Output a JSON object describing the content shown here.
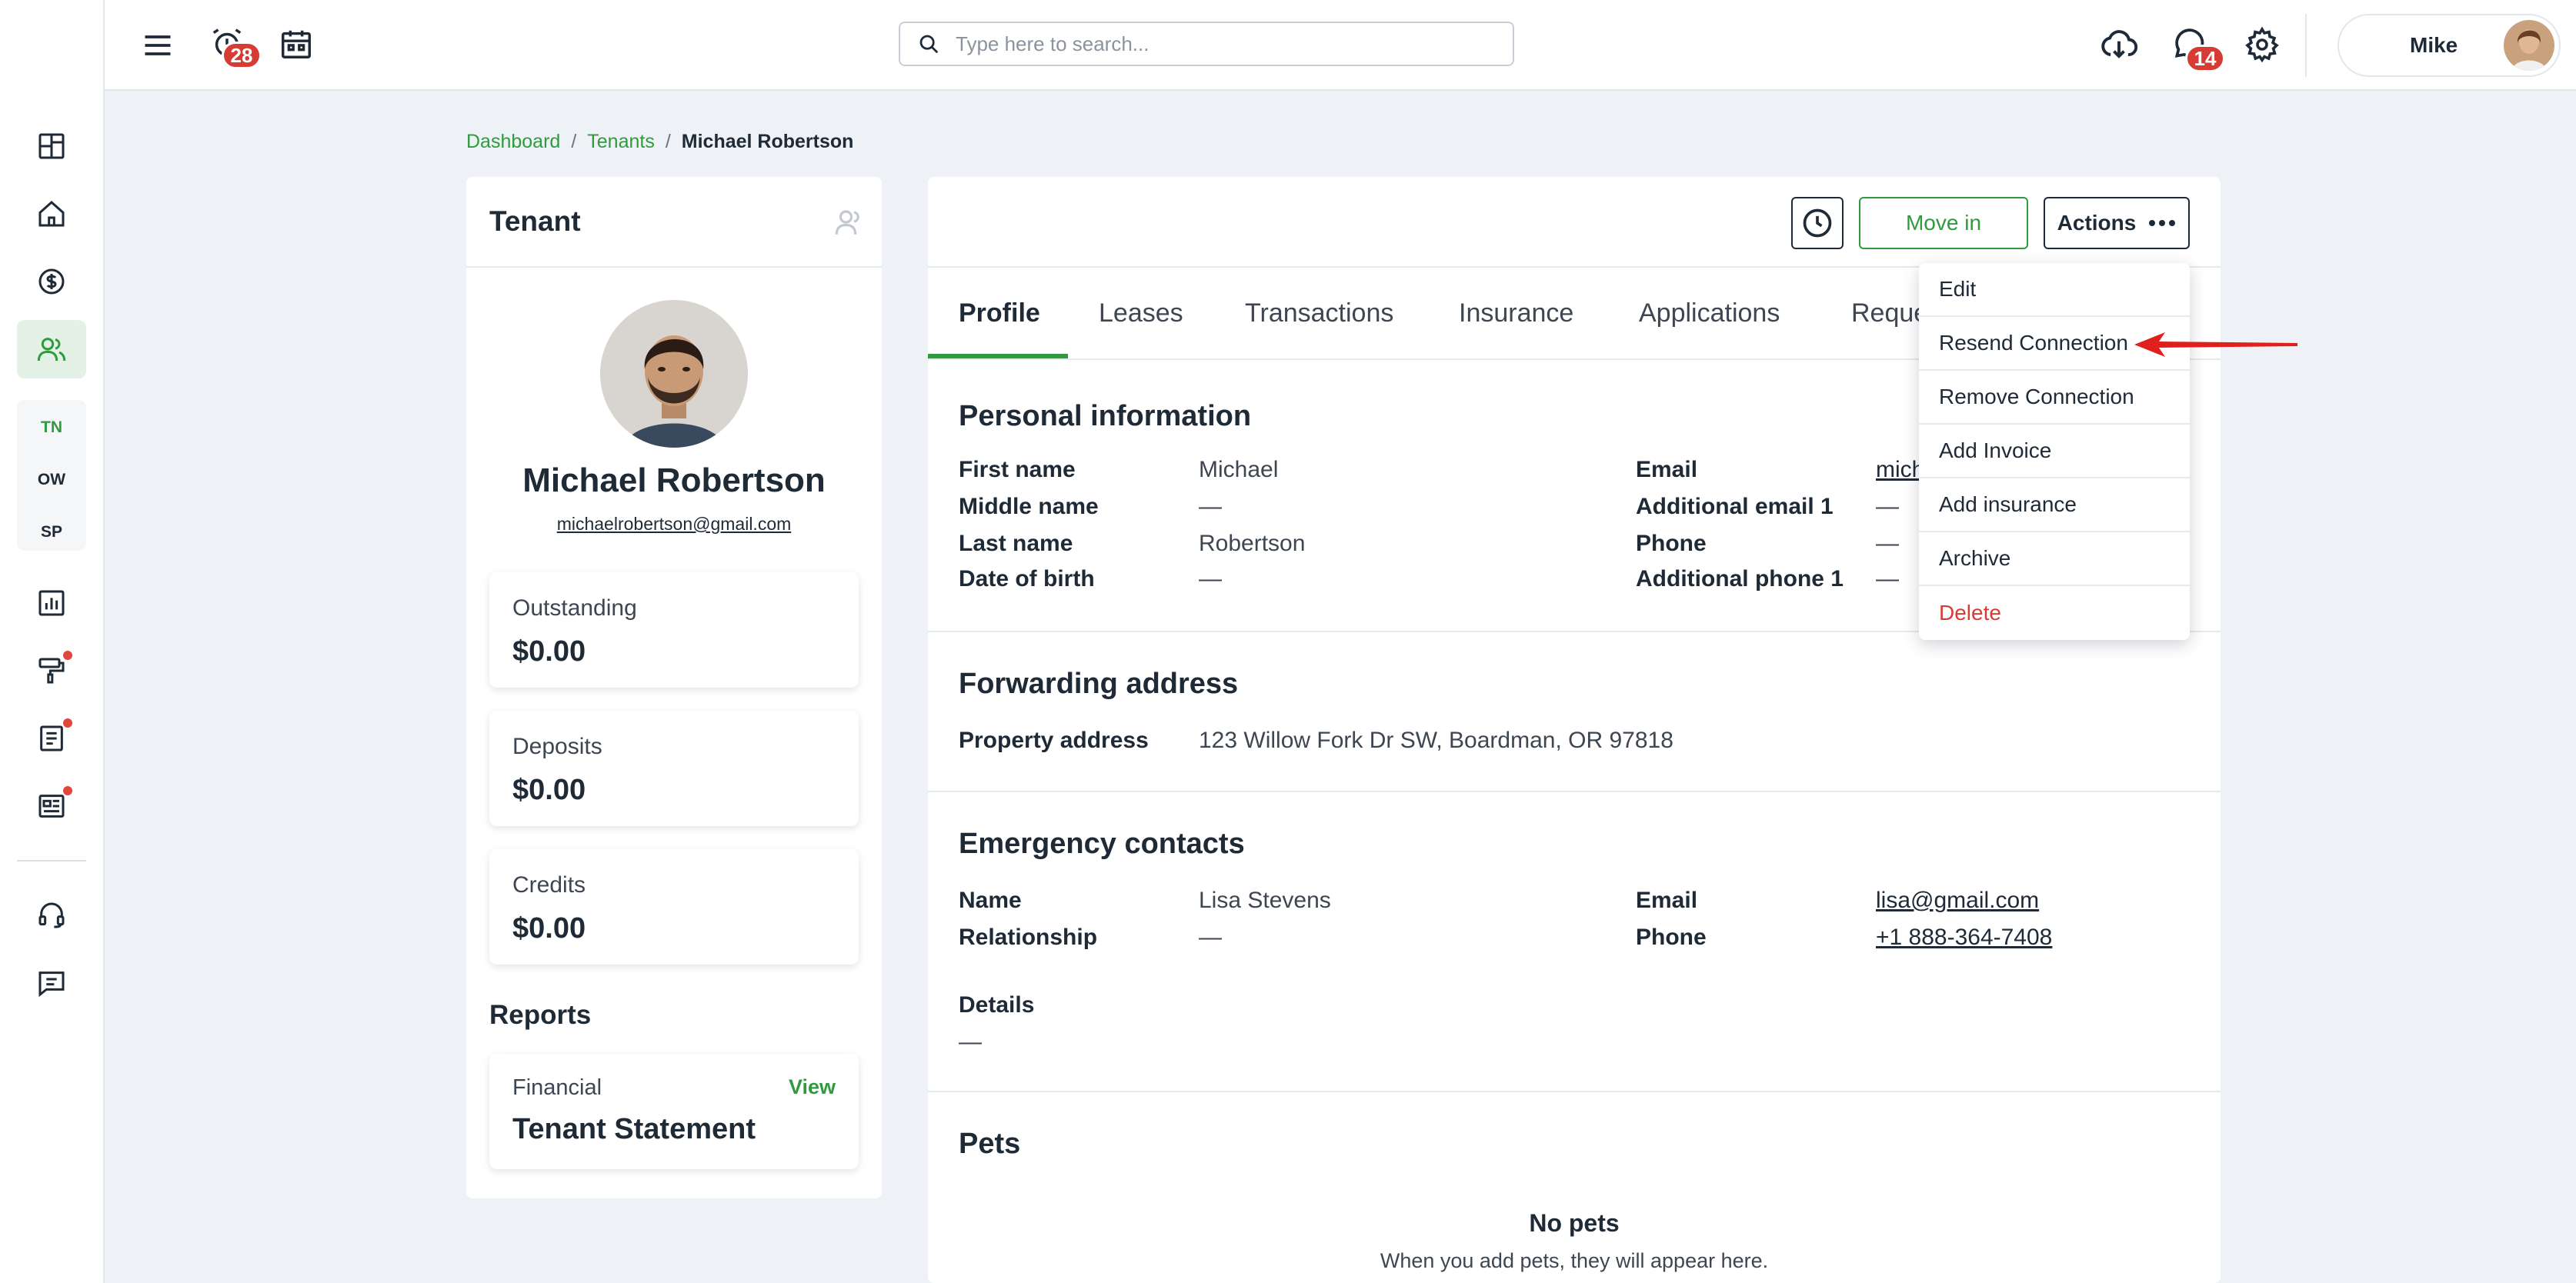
{
  "topbar": {
    "alerts_badge": "28",
    "messages_badge": "14",
    "search_placeholder": "Type here to search...",
    "user_name": "Mike"
  },
  "sidebar": {
    "items": [
      {
        "icon": "dashboard-grid-icon"
      },
      {
        "icon": "home-icon"
      },
      {
        "icon": "dollar-circle-icon"
      },
      {
        "icon": "people-icon",
        "active": true
      }
    ],
    "sub_items": [
      "TN",
      "OW",
      "SP"
    ],
    "bottom_items": [
      {
        "icon": "bar-chart-icon"
      },
      {
        "icon": "paint-roller-icon"
      },
      {
        "icon": "document-icon"
      },
      {
        "icon": "newspaper-icon"
      },
      {
        "icon": "headset-icon"
      },
      {
        "icon": "chat-icon"
      }
    ]
  },
  "breadcrumb": {
    "items": [
      "Dashboard",
      "Tenants"
    ],
    "separator": "/",
    "current": "Michael Robertson"
  },
  "tenant": {
    "heading": "Tenant",
    "name": "Michael Robertson",
    "email": "michaelrobertson@gmail.com",
    "outstanding_label": "Outstanding",
    "outstanding_value": "$0.00",
    "deposits_label": "Deposits",
    "deposits_value": "$0.00",
    "credits_label": "Credits",
    "credits_value": "$0.00",
    "reports_heading": "Reports",
    "report_category": "Financial",
    "report_view": "View",
    "report_title": "Tenant Statement"
  },
  "main": {
    "move_in_label": "Move in",
    "actions_label": "Actions",
    "tabs": [
      "Profile",
      "Leases",
      "Transactions",
      "Insurance",
      "Applications",
      "Reque"
    ],
    "personal": {
      "title": "Personal information",
      "first_name_label": "First name",
      "first_name": "Michael",
      "middle_name_label": "Middle name",
      "middle_name": "—",
      "last_name_label": "Last name",
      "last_name": "Robertson",
      "dob_label": "Date of birth",
      "dob": "—",
      "email_label": "Email",
      "email": "mich",
      "add_email_label": "Additional email 1",
      "add_email": "—",
      "phone_label": "Phone",
      "phone": "—",
      "add_phone_label": "Additional phone 1",
      "add_phone": "—"
    },
    "forwarding": {
      "title": "Forwarding address",
      "property_label": "Property address",
      "property": "123 Willow Fork Dr SW, Boardman, OR 97818"
    },
    "emergency": {
      "title": "Emergency contacts",
      "name_label": "Name",
      "name": "Lisa Stevens",
      "relationship_label": "Relationship",
      "relationship": "—",
      "email_label": "Email",
      "email": "lisa@gmail.com",
      "phone_label": "Phone",
      "phone": "+1 888-364-7408",
      "details_label": "Details",
      "details": "—"
    },
    "pets": {
      "title": "Pets",
      "empty_title": "No pets",
      "empty_sub": "When you add pets, they will appear here."
    }
  },
  "actions_menu": {
    "items": [
      "Edit",
      "Resend Connection",
      "Remove Connection",
      "Add Invoice",
      "Add insurance",
      "Archive",
      "Delete"
    ]
  },
  "colors": {
    "accent": "#2e9b3d",
    "danger": "#d63b34",
    "annotation_arrow": "#e0201b"
  }
}
